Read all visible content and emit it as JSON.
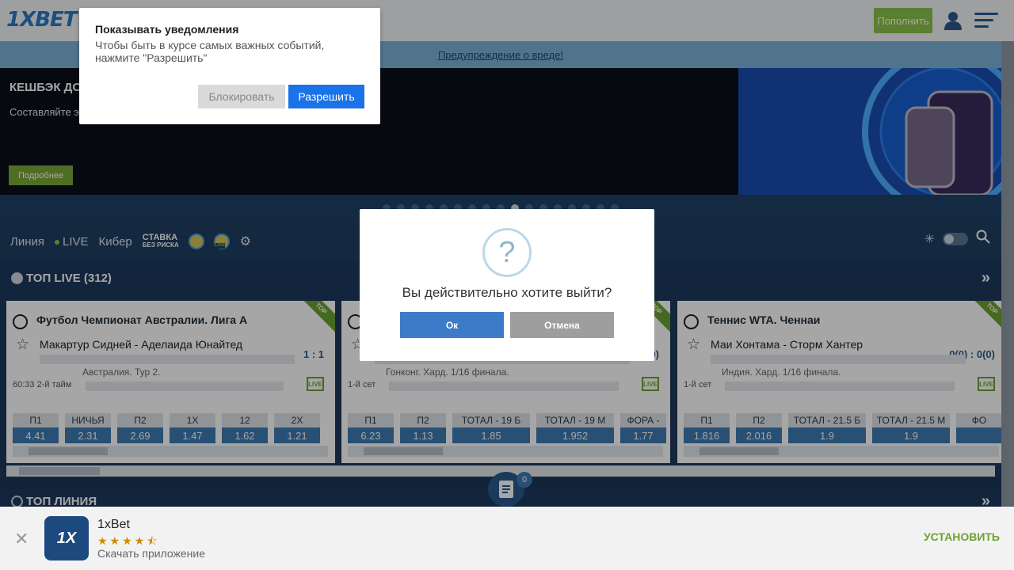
{
  "header": {
    "logo": "1XBET",
    "deposit_label": "Пополнить"
  },
  "warning_link": "Предупреждение о вреде!",
  "banner": {
    "title": "КЕШБЭК ДО З",
    "subtitle": "Составляйте эк",
    "more_label": "Подробнее"
  },
  "nav": {
    "line": "Линия",
    "live": "LIVE",
    "cyber": "Кибер",
    "stavka": "СТАВКА",
    "stavka_sub": "БЕЗ РИСКА",
    "live_badge": "LIVE"
  },
  "top_live": {
    "title": "ТОП LIVE (312)"
  },
  "cards": [
    {
      "corner": "TOP",
      "title": "Футбол Чемпионат Австралии. Лига А",
      "teams": "Макартур Сидней - Аделаида Юнайтед",
      "score": "1 : 1",
      "round": "Австралия. Тур 2.",
      "time": "60:33 2-й тайм",
      "live": "LIVE",
      "odds": [
        {
          "label": "П1",
          "value": "4.41"
        },
        {
          "label": "НИЧЬЯ",
          "value": "2.31"
        },
        {
          "label": "П2",
          "value": "2.69"
        },
        {
          "label": "1X",
          "value": "1.47"
        },
        {
          "label": "12",
          "value": "1.62"
        },
        {
          "label": "2X",
          "value": "1.21"
        }
      ]
    },
    {
      "corner": "TOP",
      "title": "",
      "teams": "",
      "score": "0)",
      "round": "Гонконг. Хард. 1/16 финала.",
      "time": "1-й сет",
      "live": "LIVE",
      "odds": [
        {
          "label": "П1",
          "value": "6.23"
        },
        {
          "label": "П2",
          "value": "1.13"
        },
        {
          "label": "ТОТАЛ - 19 Б",
          "value": "1.85"
        },
        {
          "label": "ТОТАЛ - 19 М",
          "value": "1.952"
        },
        {
          "label": "ФОРА -",
          "value": "1.77"
        }
      ]
    },
    {
      "corner": "TOP",
      "title": "Теннис WTA. Ченнаи",
      "teams": "Маи Хонтама - Сторм Хантер",
      "score": "0(0) : 0(0)",
      "round": "Индия. Хард. 1/16 финала.",
      "time": "1-й сет",
      "live": "LIVE",
      "odds": [
        {
          "label": "П1",
          "value": "1.816"
        },
        {
          "label": "П2",
          "value": "2.016"
        },
        {
          "label": "ТОТАЛ - 21.5 Б",
          "value": "1.9"
        },
        {
          "label": "ТОТАЛ - 21.5 М",
          "value": "1.9"
        },
        {
          "label": "ФО",
          "value": ""
        }
      ]
    }
  ],
  "top_line": {
    "title": "ТОП ЛИНИЯ"
  },
  "bet_slip_count": "0",
  "install": {
    "icon": "1X",
    "name": "1xBet",
    "stars": "★★★★⯪",
    "subtitle": "Скачать приложение",
    "button": "УСТАНОВИТЬ"
  },
  "notification": {
    "title": "Показывать уведомления",
    "text": "Чтобы быть в курсе самых важных событий, нажмите \"Разрешить\"",
    "block": "Блокировать",
    "allow": "Разрешить"
  },
  "modal": {
    "icon": "?",
    "text": "Вы действительно хотите выйти?",
    "ok": "Ок",
    "cancel": "Отмена"
  }
}
